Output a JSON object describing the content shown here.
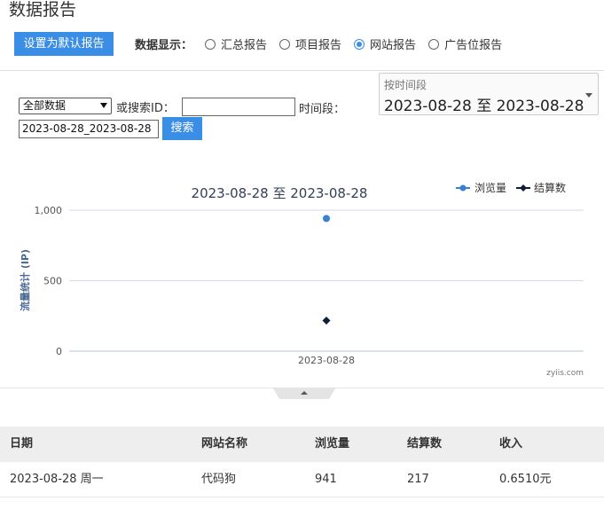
{
  "page": {
    "title": "数据报告"
  },
  "toolbar": {
    "default_button": "设置为默认报告",
    "display_label": "数据显示：",
    "options": [
      {
        "label": "汇总报告",
        "checked": false
      },
      {
        "label": "项目报告",
        "checked": false
      },
      {
        "label": "网站报告",
        "checked": true
      },
      {
        "label": "广告位报告",
        "checked": false
      }
    ]
  },
  "filter": {
    "select_value": "全部数据",
    "or_search_label": "或搜索ID：",
    "id_value": "",
    "period_label": "时间段：",
    "date_value": "2023-08-28_2023-08-28",
    "search_button": "搜索"
  },
  "range": {
    "hint": "按时间段",
    "value": "2023-08-28 至 2023-08-28"
  },
  "chart_data": {
    "type": "scatter",
    "title": "2023-08-28 至 2023-08-28",
    "ylabel": "流量统计 (IP)",
    "xlabel": "",
    "categories": [
      "2023-08-28"
    ],
    "ylim": [
      0,
      1000
    ],
    "yticks": [
      "0",
      "500",
      "1,000"
    ],
    "grid": true,
    "legend_position": "top-right",
    "credit": "zyiis.com",
    "series": [
      {
        "name": "浏览量",
        "values": [
          941
        ],
        "color": "#3a7fd5",
        "marker": "circle"
      },
      {
        "name": "结算数",
        "values": [
          217
        ],
        "color": "#0f1f3a",
        "marker": "diamond"
      }
    ]
  },
  "table": {
    "headers": [
      "日期",
      "网站名称",
      "浏览量",
      "结算数",
      "收入"
    ],
    "rows": [
      [
        "2023-08-28 周一",
        "代码狗",
        "941",
        "217",
        "0.6510元"
      ]
    ]
  }
}
